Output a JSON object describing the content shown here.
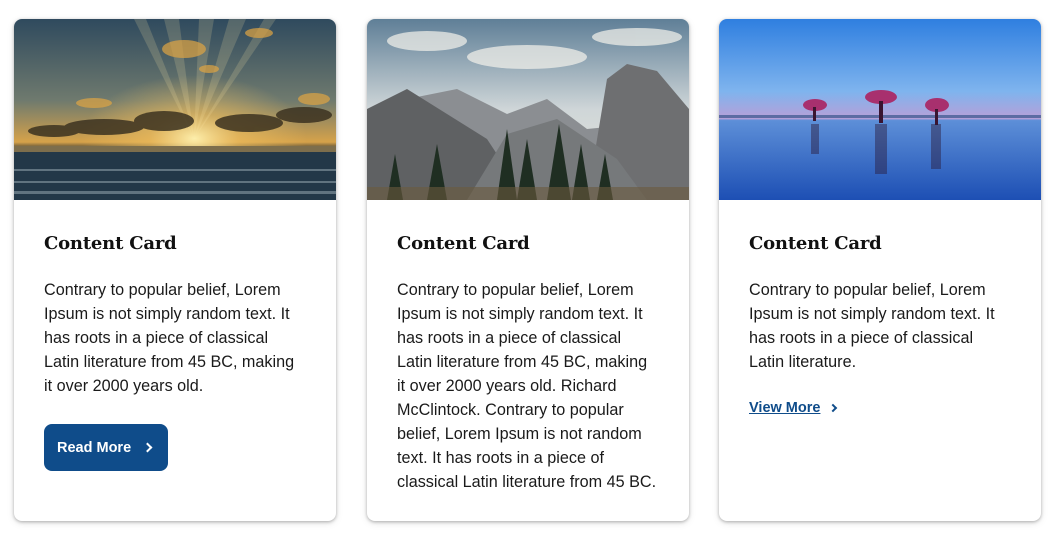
{
  "cards": [
    {
      "image_alt": "Sunset over ocean with sun rays through clouds",
      "title": "Content Card",
      "text": "Contrary to popular belief, Lorem Ipsum is not simply random text. It has roots in a piece of classical Latin literature from 45 BC, making it over 2000 years old.",
      "action": {
        "type": "button",
        "label": "Read More",
        "icon": "chevron-right-icon"
      }
    },
    {
      "image_alt": "Mountain valley with granite dome and pine trees",
      "title": "Content Card",
      "text": "Contrary to popular belief, Lorem Ipsum is not simply random text. It has roots in a piece of classical Latin literature from 45 BC, making it over 2000 years old. Richard McClintock. Contrary to popular belief, Lorem Ipsum is not random text. It has roots in a piece of classical Latin literature from 45 BC.",
      "action": null
    },
    {
      "image_alt": "Calm lake with three pink trees reflected in the water",
      "title": "Content Card",
      "text": "Contrary to popular belief, Lorem Ipsum is not simply random text. It has roots in a piece of classical Latin literature.",
      "action": {
        "type": "link",
        "label": "View More",
        "icon": "chevron-right-icon"
      }
    }
  ],
  "colors": {
    "primary": "#0f4c8a",
    "text": "#1a1a1a",
    "title": "#111111",
    "card_bg": "#ffffff"
  }
}
